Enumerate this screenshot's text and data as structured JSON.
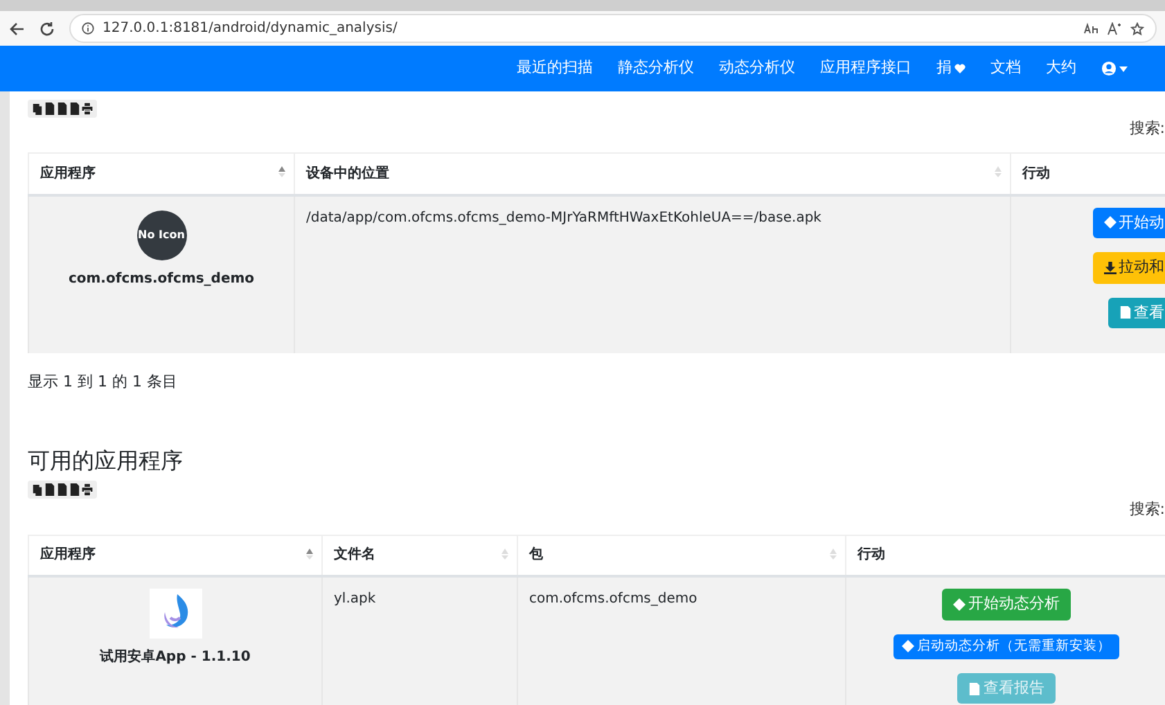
{
  "browser": {
    "url": "127.0.0.1:8181/android/dynamic_analysis/"
  },
  "navbar": {
    "items": [
      {
        "label": "最近的扫描",
        "kind": "text"
      },
      {
        "label": "静态分析仪",
        "kind": "text"
      },
      {
        "label": "动态分析仪",
        "kind": "text"
      },
      {
        "label": "应用程序接口",
        "kind": "text"
      },
      {
        "label": "捐",
        "kind": "heart"
      },
      {
        "label": "文档",
        "kind": "text"
      },
      {
        "label": "大约",
        "kind": "text"
      }
    ]
  },
  "device_apps": {
    "search_label": "搜索:",
    "columns": [
      {
        "label": "应用程序",
        "kind": "sorted"
      },
      {
        "label": "设备中的位置",
        "kind": "sortable"
      },
      {
        "label": "行动",
        "kind": "plain"
      }
    ],
    "rows": [
      {
        "icon_text": "No Icon",
        "name": "com.ofcms.ofcms_demo",
        "location": "/data/app/com.ofcms.ofcms_demo-MJrYaRMftHWaxEtKohleUA==/base.apk",
        "actions": [
          {
            "label": "开始动",
            "color": "#007bff",
            "kind": "play",
            "small": false,
            "disabled": false
          },
          {
            "label": "拉动和",
            "color": "#ffc107",
            "kind": "download",
            "small": false,
            "disabled": false
          },
          {
            "label": "查看",
            "color": "#17a2b8",
            "kind": "file",
            "small": false,
            "disabled": false
          }
        ]
      }
    ],
    "info": "显示 1 到 1 的 1 条目"
  },
  "available_apps": {
    "title": "可用的应用程序",
    "search_label": "搜索:",
    "columns": [
      {
        "label": "应用程序",
        "kind": "sorted"
      },
      {
        "label": "文件名",
        "kind": "sortable"
      },
      {
        "label": "包",
        "kind": "sortable"
      },
      {
        "label": "行动",
        "kind": "plain"
      }
    ],
    "rows": [
      {
        "name": "试用安卓App - 1.1.10",
        "file": "yl.apk",
        "package": "com.ofcms.ofcms_demo",
        "actions": [
          {
            "label": "开始动态分析",
            "color": "#28a745",
            "kind": "play",
            "small": false,
            "disabled": false
          },
          {
            "label": "启动动态分析（无需重新安装）",
            "color": "#007bff",
            "kind": "play",
            "small": true,
            "disabled": false
          },
          {
            "label": "查看报告",
            "color": "#5dbdcc",
            "kind": "file",
            "small": false,
            "disabled": true
          }
        ]
      }
    ]
  }
}
